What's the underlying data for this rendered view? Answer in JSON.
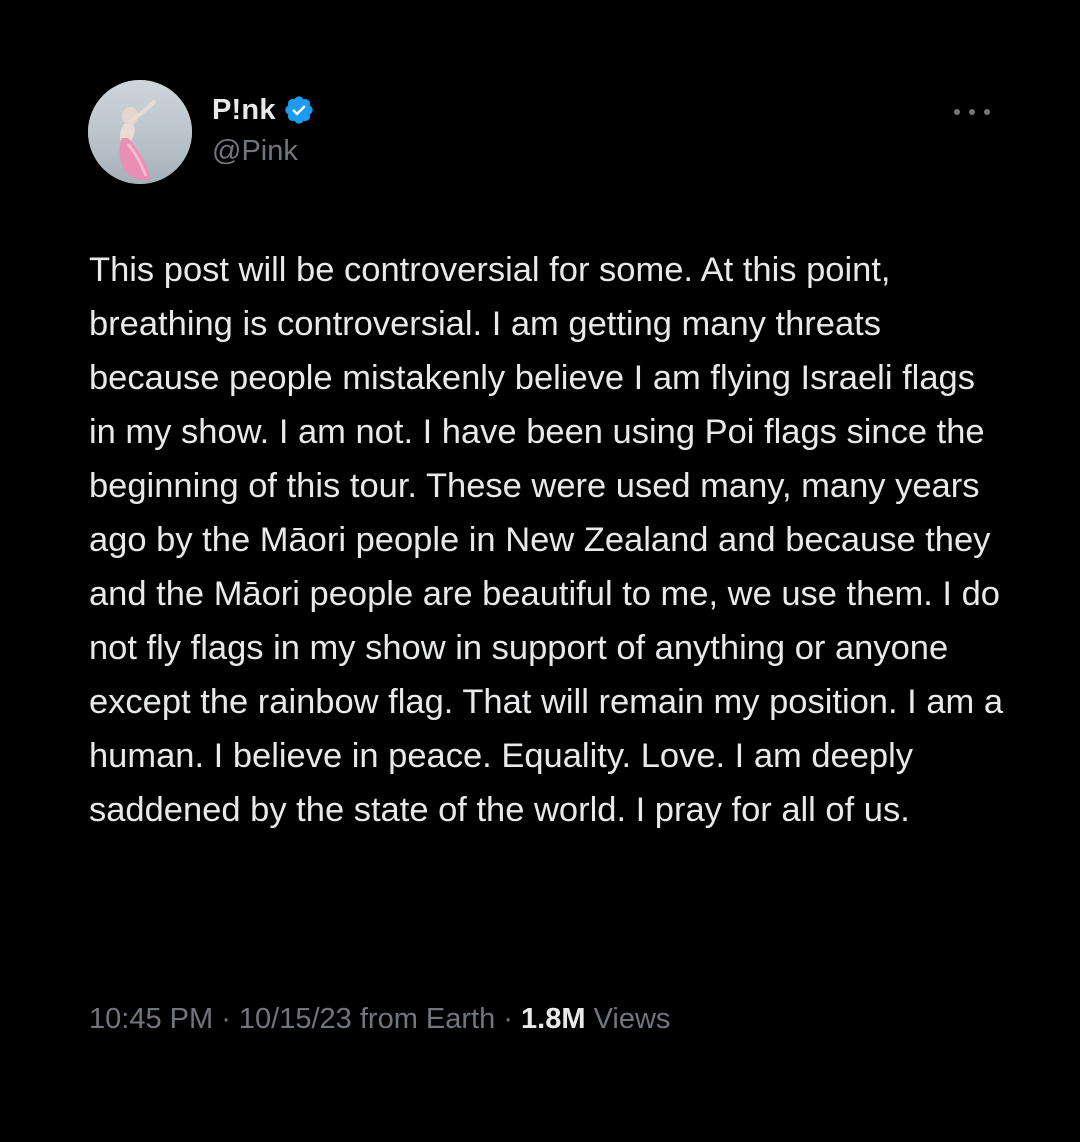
{
  "user": {
    "display_name": "P!nk",
    "handle": "@Pink",
    "verified": true
  },
  "post": {
    "text": "This post will be controversial for some. At this point, breathing is controversial. I am getting many threats because people mistakenly believe I am flying Israeli flags in my show. I am not. I have been using Poi flags since the beginning of this tour. These were used many, many years ago by the Māori people in New Zealand and because they and the Māori people are beautiful to me, we use them. I do not fly flags in my show in support of anything or anyone except the rainbow flag. That will remain my position. I am a human. I believe in peace. Equality. Love. I am deeply saddened by the state of the world. I pray for all of us."
  },
  "meta": {
    "time": "10:45 PM",
    "separator": " · ",
    "date": "10/15/23",
    "source": "from Earth",
    "views_count": "1.8M",
    "views_label": "Views"
  },
  "icons": {
    "verified": "verified-badge-icon",
    "more": "more-options-icon"
  },
  "colors": {
    "background": "#000000",
    "primary_text": "#e7e9ea",
    "secondary_text": "#71767b",
    "verified_blue": "#1d9bf0"
  }
}
